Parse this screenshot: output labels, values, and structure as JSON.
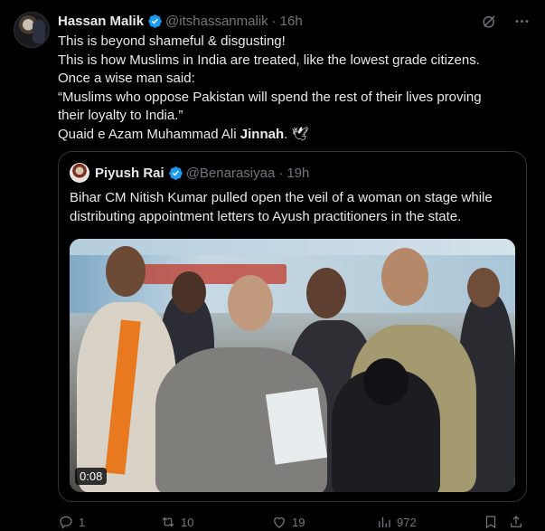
{
  "tweet": {
    "author_name": "Hassan Malik",
    "handle": "@itshassanmalik",
    "time": "16h",
    "lines": [
      "This is beyond shameful & disgusting!",
      "This is how Muslims in India are treated, like the lowest grade citizens.",
      "Once a wise man said:",
      "“Muslims who oppose Pakistan will spend the rest of their lives proving",
      "their loyalty to India.”"
    ],
    "last_line_prefix": "Quaid e Azam Muhammad Ali ",
    "last_line_bold": "Jinnah",
    "last_line_suffix": ". 🕊"
  },
  "quote": {
    "author_name": "Piyush Rai",
    "handle": "@Benarasiyaa",
    "time": "19h",
    "lines": [
      "Bihar CM Nitish Kumar pulled open the veil of a woman on stage while",
      "distributing appointment letters to Ayush practitioners in the state."
    ],
    "video_duration": "0:08"
  },
  "actions": {
    "replies": "1",
    "reposts": "10",
    "likes": "19",
    "views": "972"
  },
  "icons": {
    "verified": "verified-badge-icon",
    "grok": "grok-icon",
    "more": "more-icon",
    "reply": "reply-icon",
    "repost": "repost-icon",
    "like": "like-icon",
    "views": "views-icon",
    "bookmark": "bookmark-icon",
    "share": "share-icon"
  },
  "colors": {
    "background": "#000000",
    "text": "#e7e9ea",
    "muted": "#71767b",
    "verified": "#1d9bf0",
    "border": "#2f3336"
  }
}
